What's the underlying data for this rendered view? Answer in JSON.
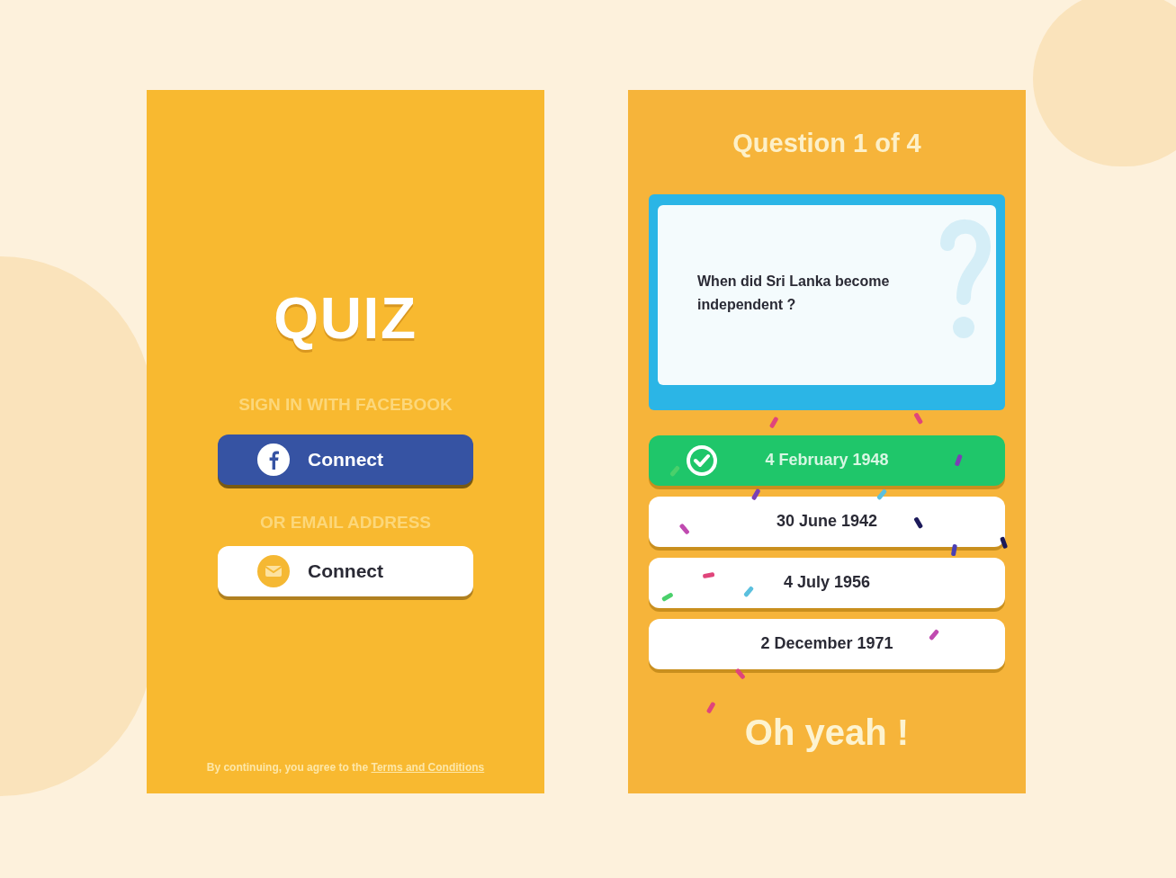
{
  "login_screen": {
    "logo": "QUIZ",
    "facebook_label": "SIGN IN WITH FACEBOOK",
    "facebook_button": "Connect",
    "email_label": "OR EMAIL ADDRESS",
    "email_button": "Connect",
    "footer": {
      "text": "By continuing, you agree to the",
      "link": "Terms and Conditions"
    }
  },
  "question_screen": {
    "title": "Question 1 of 4",
    "question": "When did Sri Lanka become independent ?",
    "answers": [
      {
        "label": "4 February 1948",
        "correct": true
      },
      {
        "label": "30 June 1942",
        "correct": false
      },
      {
        "label": "4 July 1956",
        "correct": false
      },
      {
        "label": "2 December 1971",
        "correct": false
      }
    ],
    "feedback": "Oh yeah !"
  }
}
